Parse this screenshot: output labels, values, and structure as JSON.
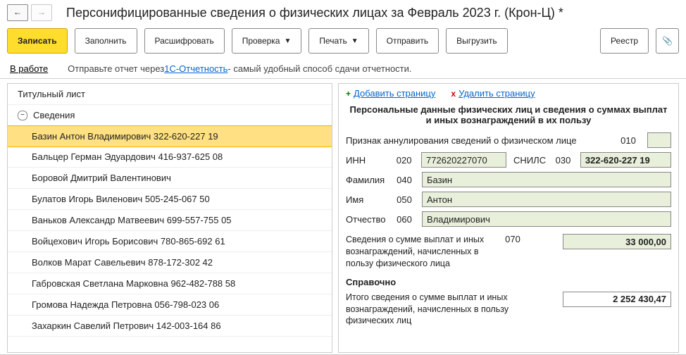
{
  "title": "Персонифицированные сведения о физических лицах за Февраль 2023 г. (Крон-Ц) *",
  "nav": {
    "back": "←",
    "fwd": "→"
  },
  "toolbar": {
    "save": "Записать",
    "fill": "Заполнить",
    "decode": "Расшифровать",
    "check": "Проверка",
    "print": "Печать",
    "send": "Отправить",
    "export": "Выгрузить",
    "registry": "Реестр"
  },
  "status": {
    "state": "В работе",
    "pre": "Отправьте отчет через ",
    "link": "1С-Отчетность",
    "post": " - самый удобный способ сдачи отчетности."
  },
  "tree": {
    "title_page": "Титульный лист",
    "info_node": "Сведения",
    "items": [
      "Базин Антон Владимирович 322-620-227 19",
      "Бальцер Герман Эдуардович 416-937-625 08",
      "Боровой Дмитрий Валентинович",
      "Булатов Игорь Виленович 505-245-067 50",
      "Ваньков Александр Матвеевич 699-557-755 05",
      "Войцехович Игорь Борисович 780-865-692 61",
      "Волков Марат Савельевич 878-172-302 42",
      "Габровская Светлана Марковна 962-482-788 58",
      "Громова Надежда Петровна 056-798-023 06",
      "Захаркин Савелий Петрович 142-003-164 86"
    ]
  },
  "page_ctl": {
    "add": "Добавить страницу",
    "del": "Удалить страницу"
  },
  "form": {
    "section_title": "Персональные данные физических лиц и сведения о суммах выплат и иных вознаграждений в их пользу",
    "annul_lbl": "Признак аннулирования сведений о физическом лице",
    "annul_code": "010",
    "inn_lbl": "ИНН",
    "inn_code": "020",
    "inn": "772620227070",
    "snils_lbl": "СНИЛС",
    "snils_code": "030",
    "snils": "322-620-227 19",
    "fam_lbl": "Фамилия",
    "fam_code": "040",
    "fam": "Базин",
    "name_lbl": "Имя",
    "name_code": "050",
    "name": "Антон",
    "patr_lbl": "Отчество",
    "patr_code": "060",
    "patr": "Владимирович",
    "pay_lbl": "Сведения о сумме выплат и иных вознаграждений, начисленных в пользу физического лица",
    "pay_code": "070",
    "pay": "33 000,00",
    "ref_title": "Справочно",
    "total_lbl": "Итого сведения о сумме выплат и иных вознаграждений, начисленных в пользу физических лиц",
    "total": "2 252 430,47"
  }
}
